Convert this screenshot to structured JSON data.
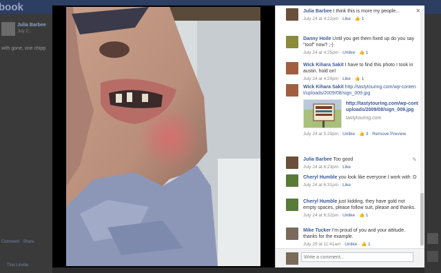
{
  "background_page": {
    "logo": "book",
    "author_name": "Julia Barbee",
    "post_date": "July 2...",
    "post_snippet": "with gone, one chipp",
    "actions": "Comment · Share",
    "commenter_name": "Tina Linville"
  },
  "theater": {
    "close_icon": "×",
    "comments": [
      {
        "author": "Julia Barbee",
        "text": "I think this is more my people...",
        "date": "July 24 at 4:22pm",
        "action": "Like",
        "likes": "1",
        "avatar_color": "#6a4f3a"
      },
      {
        "author": "Danny Hoile",
        "text": "Until you get them fixed up do you say \"toof\" now? ;-)",
        "date": "July 24 at 4:25pm",
        "action": "Unlike",
        "likes": "1",
        "avatar_color": "#8a8a3a"
      },
      {
        "author": "Wick Kihara Sakit",
        "text": "I have to find this photo I took in austin. hold on!",
        "date": "July 24 at 4:29pm",
        "action": "Like",
        "likes": "1",
        "avatar_color": "#a06040"
      },
      {
        "author": "Wick Kihara Sakit",
        "text": "http://tastytouring.com/wp-content/uploads/2009/08/sign_009.jpg",
        "date": "July 24 at 5:29pm",
        "action": "Unlike",
        "likes": "3",
        "extra": "Remove Preview",
        "avatar_color": "#a06040",
        "preview": {
          "url": "http://tastytouring.com/wp-content/uploads/2009/08/sign_009.jpg",
          "domain": "tastytouring.com"
        }
      },
      {
        "author": "Julia Barbee",
        "text": "Too good",
        "date": "July 24 at 6:23pm",
        "action": "Like",
        "avatar_color": "#6a4f3a",
        "edit_icon": "✎"
      },
      {
        "author": "Cheryl Humble",
        "text": "you look like everyone I work with :D",
        "date": "July 24 at 6:31pm",
        "action": "Like",
        "avatar_color": "#5a7a3a"
      },
      {
        "author": "Cheryl Humble",
        "text": "just kidding, they have gold not empty spaces, please follow suit, please and thanks.",
        "date": "July 24 at 6:32pm",
        "action": "Unlike",
        "likes": "1",
        "avatar_color": "#5a7a3a"
      },
      {
        "author": "Mike Tucker",
        "text": "I'm proud of you and your attitude. thanks for the example.",
        "date": "July 29 at 11:41am",
        "action": "Unlike",
        "likes": "1",
        "avatar_color": "#7a6a5a"
      }
    ],
    "composer": {
      "placeholder": "Write a comment..."
    }
  }
}
